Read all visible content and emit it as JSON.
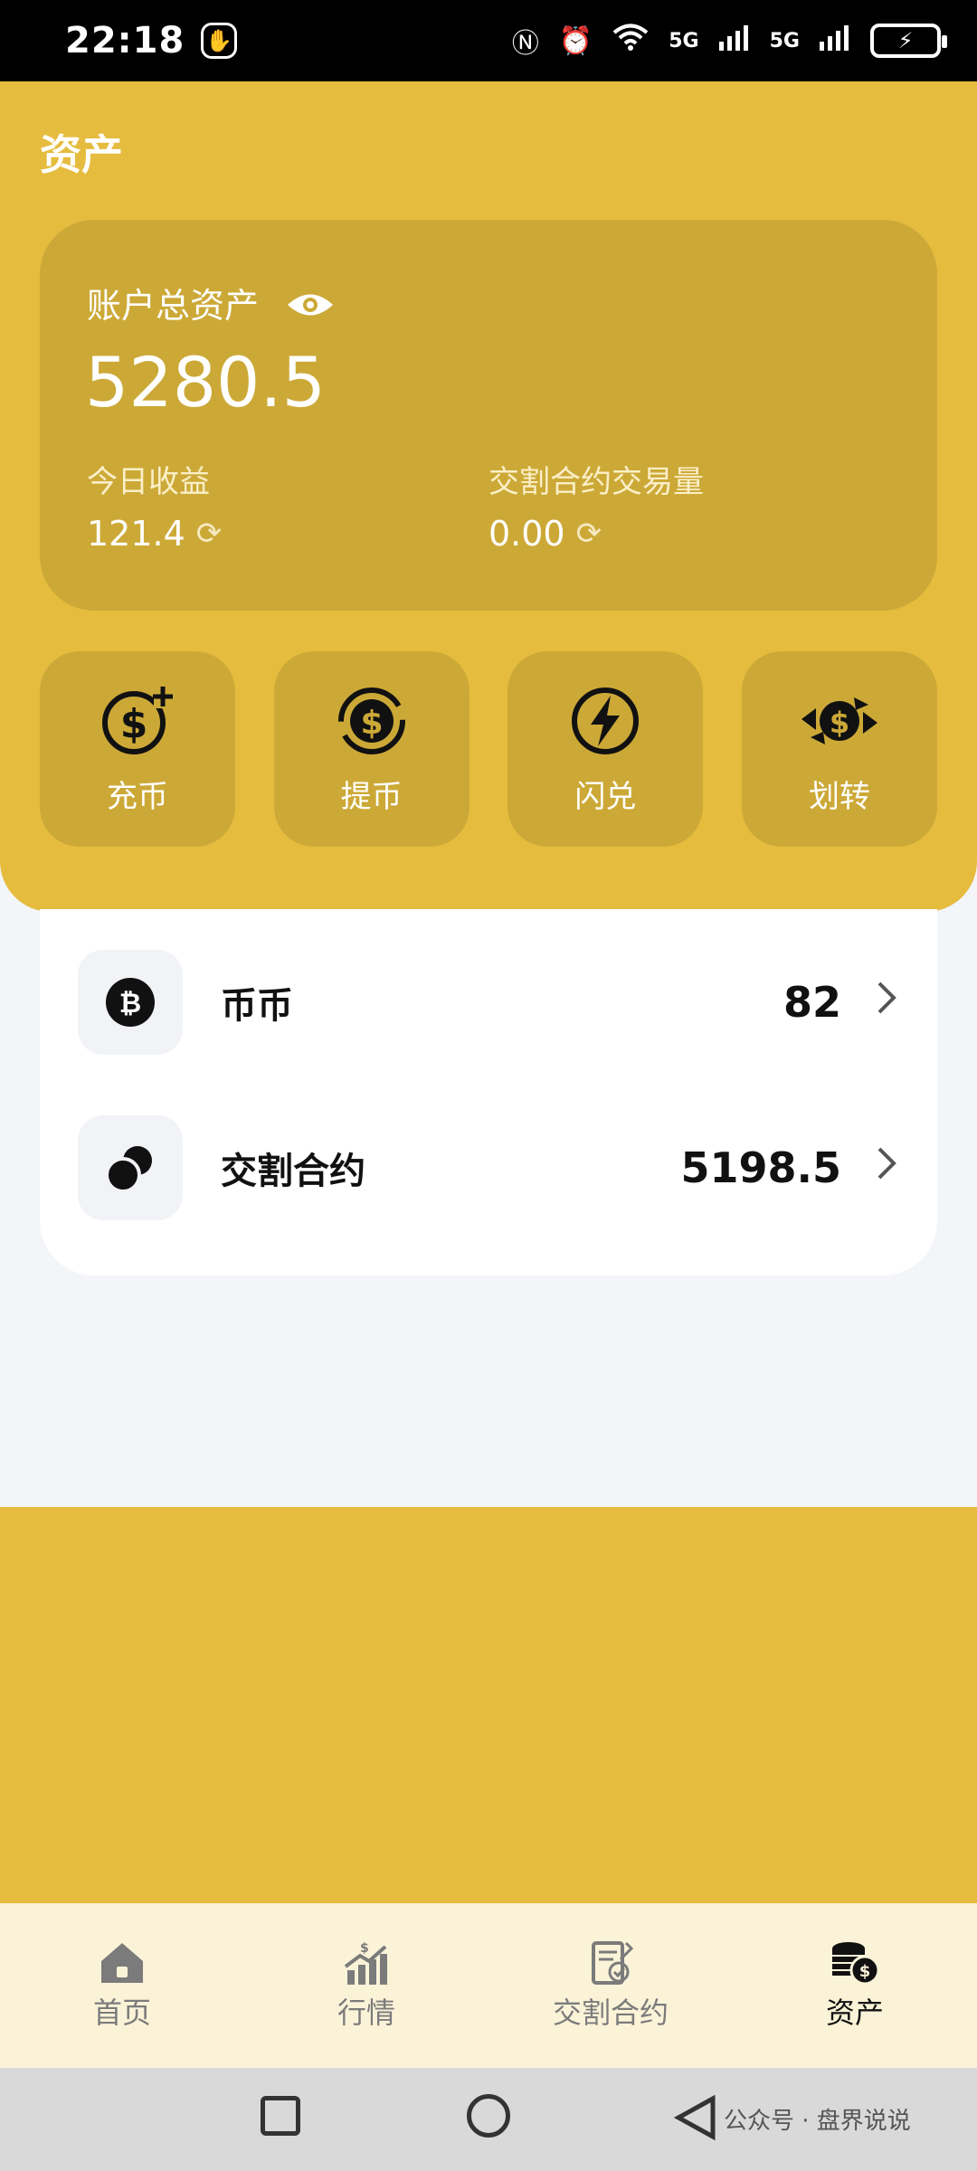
{
  "status_bar": {
    "time": "22:18",
    "signal_labels": [
      "5G",
      "5G"
    ]
  },
  "page": {
    "title": "资产"
  },
  "summary": {
    "total_label": "账户总资产",
    "total_value": "5280.5",
    "today_label": "今日收益",
    "today_value": "121.4",
    "volume_label": "交割合约交易量",
    "volume_value": "0.00"
  },
  "actions": [
    {
      "label": "充币",
      "icon": "dollar-plus-icon"
    },
    {
      "label": "提币",
      "icon": "dollar-cycle-icon"
    },
    {
      "label": "闪兑",
      "icon": "lightning-icon"
    },
    {
      "label": "划转",
      "icon": "transfer-icon"
    }
  ],
  "assets": [
    {
      "name": "币币",
      "value": "82",
      "icon": "bitcoin-icon"
    },
    {
      "name": "交割合约",
      "value": "5198.5",
      "icon": "coins-icon"
    }
  ],
  "tabs": [
    {
      "label": "首页",
      "icon": "home-icon"
    },
    {
      "label": "行情",
      "icon": "market-chart-icon"
    },
    {
      "label": "交割合约",
      "icon": "contract-icon"
    },
    {
      "label": "资产",
      "icon": "coin-stack-icon"
    }
  ],
  "watermark": "公众号 · 盘界说说",
  "colors": {
    "brand_yellow": "#e5bc3e",
    "card_yellow": "#cca937",
    "tabbar_bg": "#fbf3d8"
  }
}
